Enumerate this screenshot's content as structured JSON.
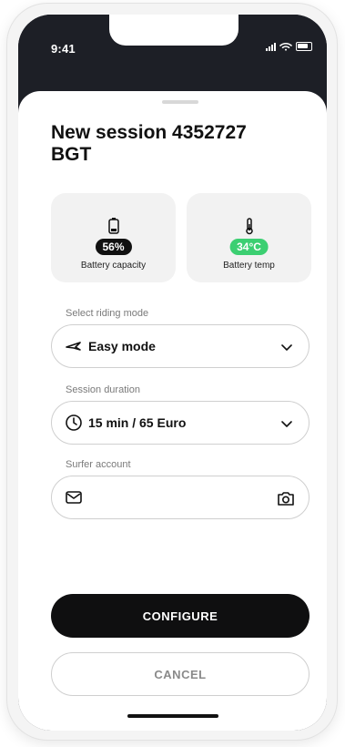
{
  "status": {
    "time": "9:41"
  },
  "session": {
    "title": "New session 4352727 BGT"
  },
  "stats": {
    "battery": {
      "value": "56%",
      "label": "Battery capacity"
    },
    "temp": {
      "value": "34°C",
      "label": "Battery temp"
    }
  },
  "fields": {
    "riding_mode": {
      "label": "Select riding mode",
      "value": "Easy mode"
    },
    "duration": {
      "label": "Session duration",
      "value": "15 min / 65 Euro"
    },
    "account": {
      "label": "Surfer account",
      "value": ""
    }
  },
  "actions": {
    "configure": "CONFIGURE",
    "cancel": "CANCEL"
  },
  "colors": {
    "dark": "#0f0f10",
    "accent_green": "#3ccf72",
    "border": "#cfcfcf"
  },
  "icons": {
    "battery": "battery-icon",
    "thermometer": "thermometer-icon",
    "mode": "surfboard-icon",
    "clock": "clock-icon",
    "mail": "mail-icon",
    "camera": "camera-icon",
    "chevron": "chevron-down-icon"
  }
}
